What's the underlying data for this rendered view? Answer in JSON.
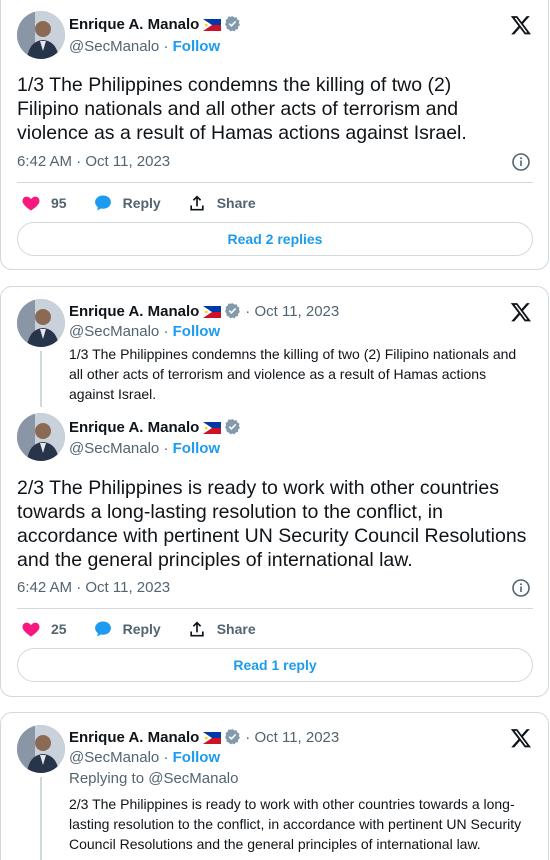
{
  "author": {
    "name": "Enrique A. Manalo",
    "handle": "@SecManalo",
    "follow_label": "Follow",
    "separator_date": "· Oct 11, 2023"
  },
  "tweet1": {
    "text": "1/3 The Philippines condemns the killing of two (2) Filipino nationals and all other acts of terrorism and violence as a result of Hamas actions against Israel.",
    "timestamp": "6:42 AM · Oct 11, 2023",
    "likes": "95",
    "reply_label": "Reply",
    "share_label": "Share",
    "read_replies": "Read 2 replies"
  },
  "tweet2": {
    "quoted_text": "1/3 The Philippines condemns the killing of two (2) Filipino nationals and all other acts of terrorism and violence as a result of Hamas actions against Israel.",
    "text": "2/3 The Philippines is ready to work with other countries towards a long-lasting resolution to the conflict, in accordance with pertinent UN Security Council Resolutions and the general principles of international law.",
    "timestamp": "6:42 AM · Oct 11, 2023",
    "likes": "25",
    "reply_label": "Reply",
    "share_label": "Share",
    "read_replies": "Read 1 reply"
  },
  "tweet3": {
    "replying_to": "Replying to @SecManalo",
    "text": "2/3 The Philippines is ready to work with other countries towards a long-lasting resolution to the conflict, in accordance with pertinent UN Security Council Resolutions and the general principles of international law."
  },
  "colors": {
    "accent": "#1d9bf0",
    "like": "#f91880",
    "muted": "#536471",
    "border": "#cfd9de"
  },
  "icons": [
    "x-logo-icon",
    "verified-badge-icon",
    "philippines-flag-icon",
    "info-icon",
    "heart-icon",
    "reply-bubble-icon",
    "share-icon"
  ]
}
